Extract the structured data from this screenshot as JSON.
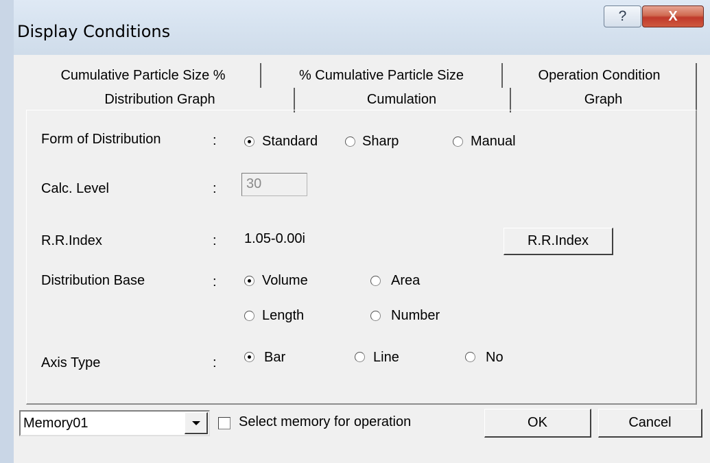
{
  "window": {
    "title": "Display Conditions",
    "help_glyph": "?",
    "close_glyph": "X"
  },
  "tabs": {
    "row1": [
      "Cumulative Particle Size %",
      "% Cumulative Particle Size",
      "Operation Condition"
    ],
    "row2": [
      "Distribution Graph",
      "Cumulation",
      "Graph"
    ],
    "active": "Distribution Graph"
  },
  "form": {
    "colon": ":",
    "distribution": {
      "label": "Form of Distribution",
      "options": [
        "Standard",
        "Sharp",
        "Manual"
      ],
      "selected": "Standard"
    },
    "calc_level": {
      "label": "Calc. Level",
      "value": "30"
    },
    "rr_index": {
      "label": "R.R.Index",
      "value": "1.05-0.00i",
      "button": "R.R.Index"
    },
    "base": {
      "label": "Distribution Base",
      "options": [
        "Volume",
        "Area",
        "Length",
        "Number"
      ],
      "selected": "Volume"
    },
    "axis": {
      "label": "Axis Type",
      "options": [
        "Bar",
        "Line",
        "No"
      ],
      "selected": "Bar"
    }
  },
  "footer": {
    "memory": "Memory01",
    "checkbox_label": "Select memory for operation",
    "checked": false,
    "ok": "OK",
    "cancel": "Cancel"
  }
}
